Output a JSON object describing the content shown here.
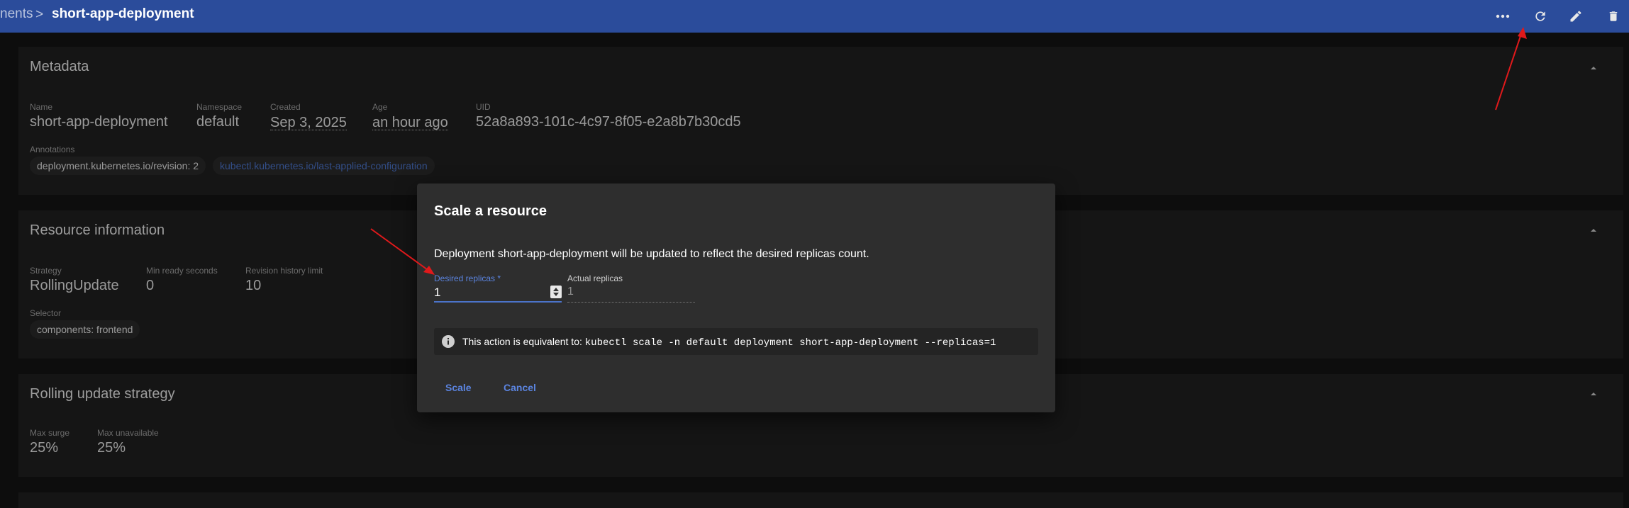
{
  "breadcrumb": {
    "prev": "nents",
    "separator": ">",
    "current": "short-app-deployment"
  },
  "toolbar": {
    "icons": [
      "more-icon",
      "refresh-icon",
      "edit-icon",
      "delete-icon"
    ]
  },
  "metadata": {
    "title": "Metadata",
    "name_label": "Name",
    "name": "short-app-deployment",
    "namespace_label": "Namespace",
    "namespace": "default",
    "created_label": "Created",
    "created": "Sep 3, 2025",
    "age_label": "Age",
    "age": "an hour ago",
    "uid_label": "UID",
    "uid": "52a8a893-101c-4c97-8f05-e2a8b7b30cd5",
    "annotations_label": "Annotations",
    "annotations": [
      "deployment.kubernetes.io/revision: 2",
      "kubectl.kubernetes.io/last-applied-configuration"
    ]
  },
  "resource_info": {
    "title": "Resource information",
    "strategy_label": "Strategy",
    "strategy": "RollingUpdate",
    "min_ready_label": "Min ready seconds",
    "min_ready": "0",
    "revision_label": "Revision history limit",
    "revision": "10",
    "selector_label": "Selector",
    "selector": "components: frontend"
  },
  "rolling_update": {
    "title": "Rolling update strategy",
    "max_surge_label": "Max surge",
    "max_surge": "25%",
    "max_unavailable_label": "Max unavailable",
    "max_unavailable": "25%"
  },
  "dialog": {
    "title": "Scale a resource",
    "description": "Deployment short-app-deployment will be updated to reflect the desired replicas count.",
    "desired_label": "Desired replicas *",
    "desired_value": "1",
    "actual_label": "Actual replicas",
    "actual_value": "1",
    "info_prefix": "This action is equivalent to:",
    "info_command": "kubectl scale -n default deployment short-app-deployment --replicas=1",
    "scale_label": "Scale",
    "cancel_label": "Cancel"
  },
  "colors": {
    "topbar": "#2b4c9b",
    "accent": "#4b73c9",
    "annotation_arrow": "#e0191b"
  }
}
